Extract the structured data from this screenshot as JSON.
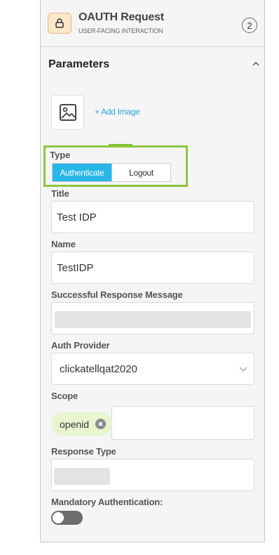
{
  "header": {
    "title": "OAUTH Request",
    "subtitle": "USER-FACING INTERACTION",
    "badge_count": "2",
    "icon": "lock-icon"
  },
  "section": {
    "title": "Parameters",
    "collapse_icon": "chevron-up-icon"
  },
  "image": {
    "icon": "image-icon",
    "add_label": "+ Add Image"
  },
  "type": {
    "label": "Type",
    "options": [
      "Authenticate",
      "Logout"
    ],
    "selected": "Authenticate"
  },
  "fields": {
    "title": {
      "label": "Title",
      "value": "Test IDP"
    },
    "name": {
      "label": "Name",
      "value": "TestIDP"
    },
    "success_message": {
      "label": "Successful Response Message",
      "value": ""
    },
    "auth_provider": {
      "label": "Auth Provider",
      "value": "clickatellqat2020"
    },
    "scope": {
      "label": "Scope",
      "chips": [
        "openid"
      ]
    },
    "response_type": {
      "label": "Response Type",
      "value": ""
    },
    "mandatory_auth": {
      "label": "Mandatory Authentication:",
      "enabled": false
    }
  },
  "colors": {
    "accent": "#29b6e8",
    "highlight_border": "#8dc63f",
    "chip_bg": "#e8f5cf",
    "link": "#2aa8d8"
  }
}
